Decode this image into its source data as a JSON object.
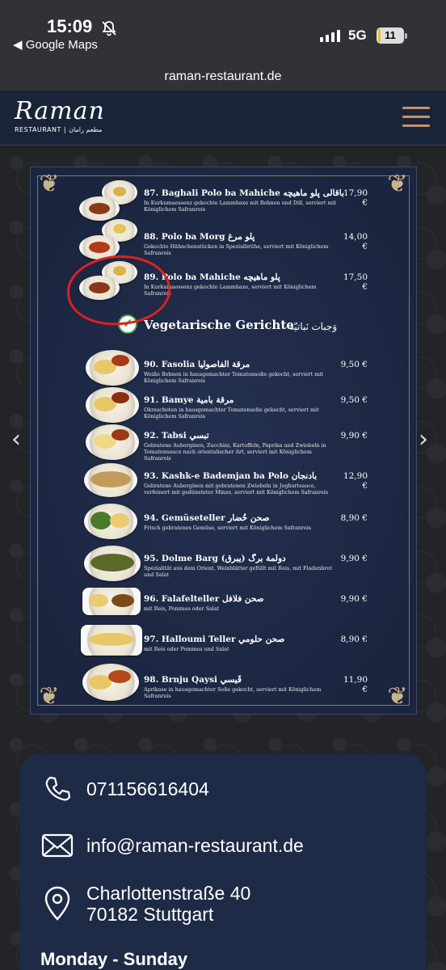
{
  "status_bar": {
    "time": "15:09",
    "back_app": "◀ Google Maps",
    "network": "5G",
    "battery": "11",
    "battery_level": 0.11,
    "icons": [
      "bell-muted-icon",
      "signal-icon",
      "battery-icon"
    ]
  },
  "browser": {
    "url": "raman-restaurant.de"
  },
  "header": {
    "logo_script": "Raman",
    "logo_sub": "RESTAURANT | مطعم رامان",
    "menu_icon": "hamburger-menu-icon"
  },
  "menu": {
    "dishes_top": [
      {
        "name": "87. Baghali Polo ba Mahiche باقالی پلو ماهیچه",
        "price": "17,90 €",
        "desc": "In Kurkumaessenz gekochte Lammhaxe mit Bohnen und Dill, serviert mit Königlichem Safranreis"
      },
      {
        "name": "88. Polo ba Morg پلو مرغ",
        "price": "14,00 €",
        "desc": "Gekochte Hähnchenstücken in Spezialbrühe, serviert mit Königlichem Safranreis"
      },
      {
        "name": "89. Polo ba Mahiche پلو ماهیچه",
        "price": "17,50 €",
        "desc": "In Kurkumaessenz gekochte Lammhaxe, serviert mit Königlichem Safranreis"
      }
    ],
    "section_title": "Vegetarische Gerichte",
    "section_title_ar": "وَجبات نَباتيّة",
    "dishes_veg": [
      {
        "name": "90. Fasolia مرقة الفاصوليا",
        "price": "9,50 €",
        "desc": "Weiße Bohnen in hausgemachter Tomatensoße gekocht, serviert mit Königlichem Safranreis"
      },
      {
        "name": "91. Bamye مرقة بامية",
        "price": "9,50 €",
        "desc": "Okraschoten in hausgemachter Tomatensoße gekocht, serviert mit Königlichem Safranreis"
      },
      {
        "name": "92. Tabsi تبسي",
        "price": "9,90 €",
        "desc": "Gebratene Auberginen, Zucchini, Kartoffeln, Paprika und Zwiebeln in Tomatensauce nach orientalischer Art, serviert mit Königlichem Safranreis"
      },
      {
        "name": "93. Kashk-e Bademjan ba Polo بادنجان",
        "price": "12,90 €",
        "desc": "Gebratene Auberginen mit gebratenen Zwiebeln in Joghurtsauce, verfeinert mit gedünsteter Minze, serviert mit Königlichem Safranreis"
      },
      {
        "name": "94. Gemüseteller صحن خُضار",
        "price": "8,90 €",
        "desc": "Frisch gebratenes Gemüse, serviert mit Königlichem Safranreis"
      },
      {
        "name": "95. Dolme Barg دولمة برگ (يبرق)",
        "price": "9,90 €",
        "desc": "Spezialität aus dem Orient, Weinblätter gefüllt mit Reis, mit Fladenbrot und Salat"
      },
      {
        "name": "96. Falafelteller صحن فلافل",
        "price": "9,90 €",
        "desc": "mit Reis, Pommes oder Salat"
      },
      {
        "name": "97. Halloumi Teller صحن حلومي",
        "price": "8,90 €",
        "desc": "mit Reis oder Pommes und Salat"
      },
      {
        "name": "98. Brnju Qaysi قَيسي",
        "price": "11,90 €",
        "desc": "Aprikose in hausgemachter Soße gekocht, serviert mit Königlichem Safranreis"
      }
    ]
  },
  "carousel": {
    "prev": "‹",
    "next": "›"
  },
  "contact": {
    "phone": "071156616404",
    "email": "info@raman-restaurant.de",
    "address_line1": "Charlottenstraße 40",
    "address_line2": "70182 Stuttgart",
    "hours_label": "Monday - Sunday"
  },
  "colors": {
    "header_bg": "#1a2438",
    "menu_bg": "#1f2a44",
    "accent": "#c98f66",
    "card_bg": "#1e2b46",
    "annotation_red": "#e02020"
  }
}
